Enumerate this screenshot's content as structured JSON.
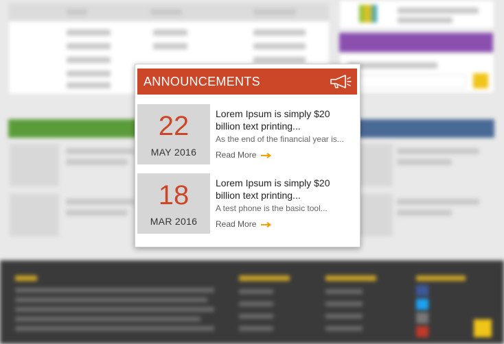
{
  "announcements": {
    "title": "ANNOUNCEMENTS",
    "header_color": "#cc4727",
    "icon": "megaphone-icon",
    "items": [
      {
        "day": "22",
        "month": "MAY 2016",
        "headline": "Lorem Ipsum is simply  $20\nbillion text printing...",
        "excerpt": "As the end of the financial year is...",
        "read_more": "Read More"
      },
      {
        "day": "18",
        "month": "MAR 2016",
        "headline": "Lorem Ipsum is simply  $20\nbillion text printing...",
        "excerpt": "A test phone is the basic tool...",
        "read_more": "Read More"
      }
    ]
  },
  "background": {
    "accent_purple": "#8b4fb0",
    "accent_green": "#5b9c3a",
    "accent_blue": "#4a6a96",
    "accent_yellow": "#f0c419",
    "footer_color": "#3a3a3a"
  }
}
